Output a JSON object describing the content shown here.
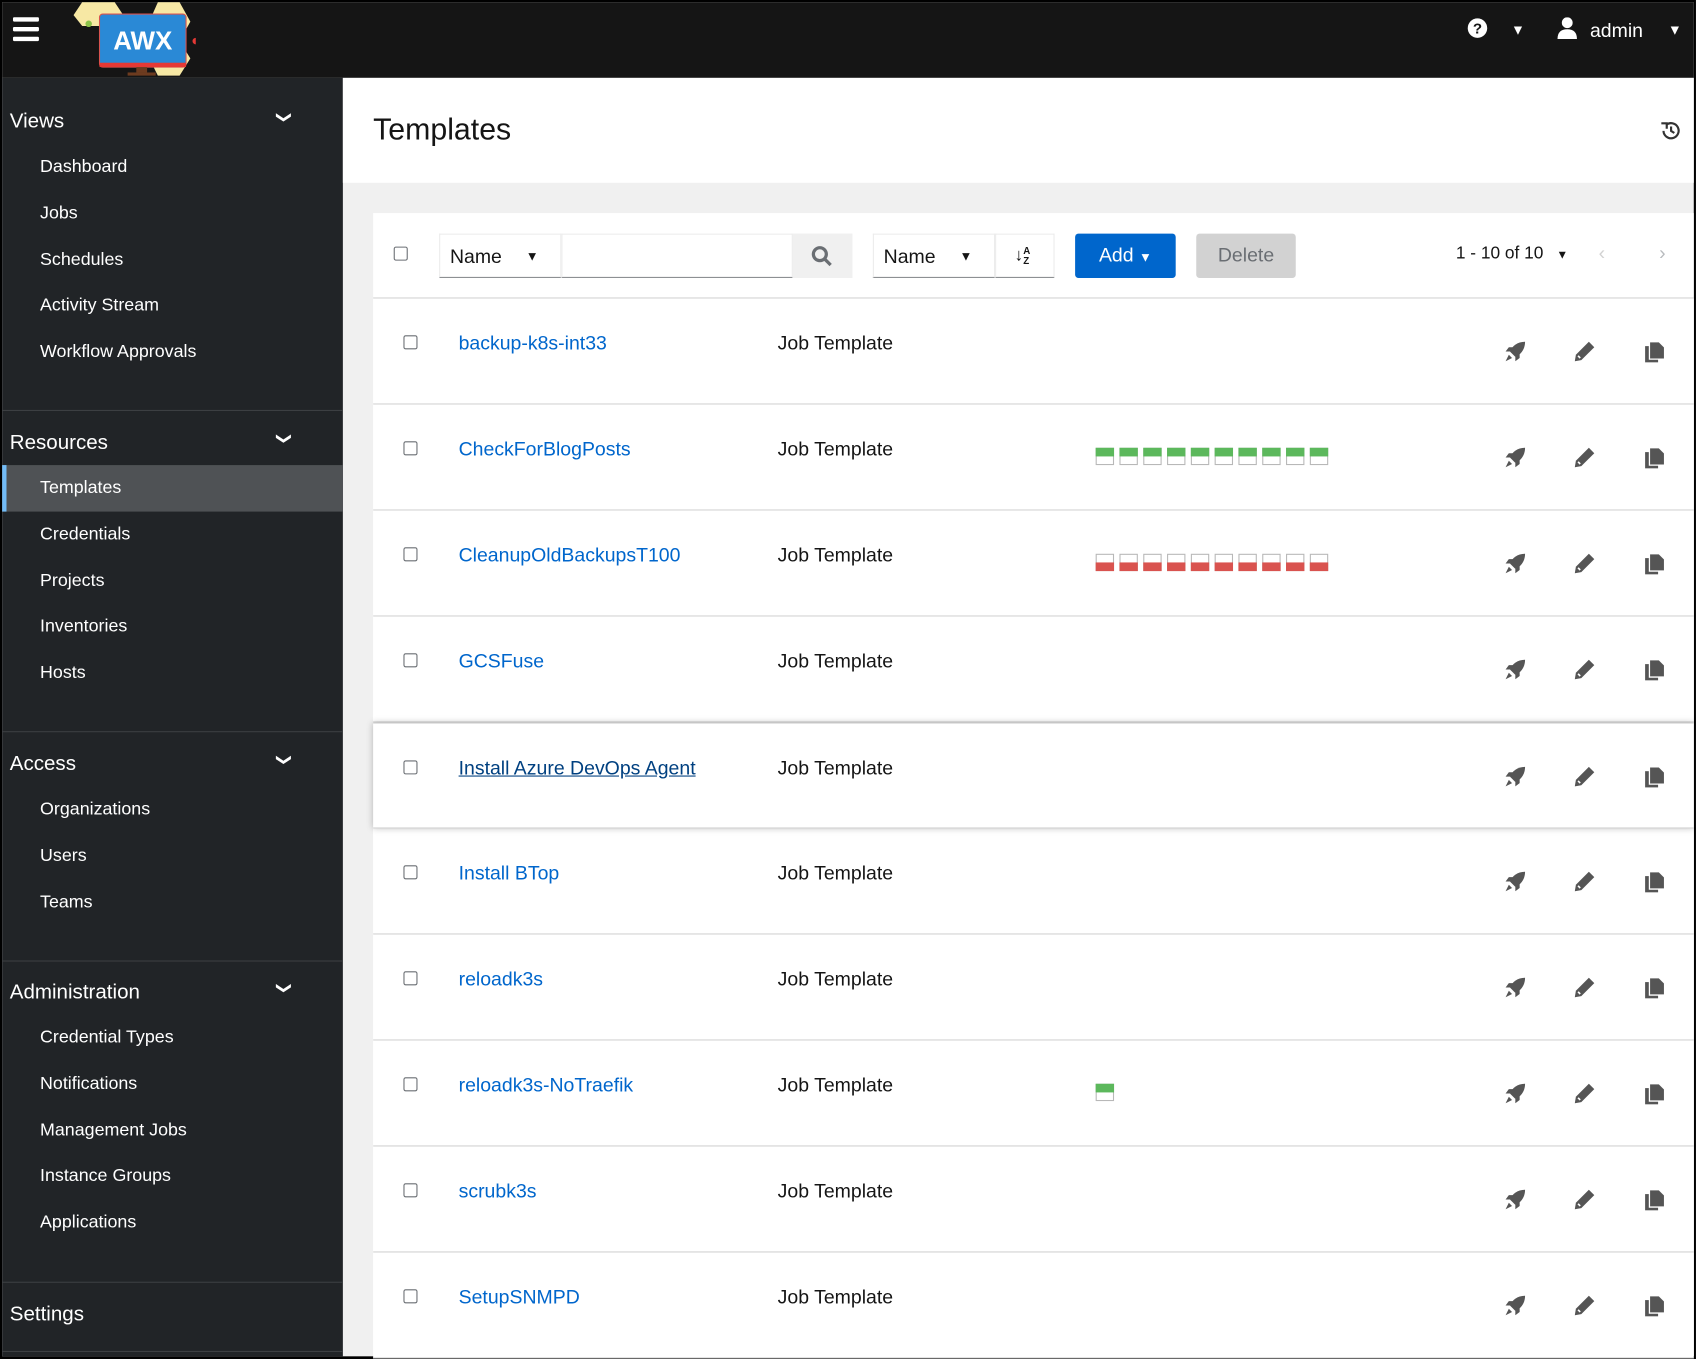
{
  "header": {
    "logo_text": "AWX",
    "user": "admin"
  },
  "sidebar": {
    "sections": [
      {
        "label": "Views",
        "items": [
          "Dashboard",
          "Jobs",
          "Schedules",
          "Activity Stream",
          "Workflow Approvals"
        ]
      },
      {
        "label": "Resources",
        "items": [
          "Templates",
          "Credentials",
          "Projects",
          "Inventories",
          "Hosts"
        ]
      },
      {
        "label": "Access",
        "items": [
          "Organizations",
          "Users",
          "Teams"
        ]
      },
      {
        "label": "Administration",
        "items": [
          "Credential Types",
          "Notifications",
          "Management Jobs",
          "Instance Groups",
          "Applications"
        ]
      },
      {
        "label": "Settings",
        "items": []
      }
    ],
    "active": "Templates"
  },
  "page": {
    "title": "Templates"
  },
  "toolbar": {
    "filter_field": "Name",
    "search_value": "",
    "sort_field": "Name",
    "add_label": "Add",
    "delete_label": "Delete",
    "pagination": "1 - 10 of 10"
  },
  "rows": [
    {
      "name": "backup-k8s-int33",
      "type": "Job Template",
      "jobs": []
    },
    {
      "name": "CheckForBlogPosts",
      "type": "Job Template",
      "jobs": [
        "successful",
        "successful",
        "successful",
        "successful",
        "successful",
        "successful",
        "successful",
        "successful",
        "successful",
        "successful"
      ]
    },
    {
      "name": "CleanupOldBackupsT100",
      "type": "Job Template",
      "jobs": [
        "failed",
        "failed",
        "failed",
        "failed",
        "failed",
        "failed",
        "failed",
        "failed",
        "failed",
        "failed"
      ]
    },
    {
      "name": "GCSFuse",
      "type": "Job Template",
      "jobs": []
    },
    {
      "name": "Install Azure DevOps Agent",
      "type": "Job Template",
      "jobs": [],
      "hovered": true
    },
    {
      "name": "Install BTop",
      "type": "Job Template",
      "jobs": []
    },
    {
      "name": "reloadk3s",
      "type": "Job Template",
      "jobs": []
    },
    {
      "name": "reloadk3s-NoTraefik",
      "type": "Job Template",
      "jobs": [
        "successful"
      ]
    },
    {
      "name": "scrubk3s",
      "type": "Job Template",
      "jobs": []
    },
    {
      "name": "SetupSNMPD",
      "type": "Job Template",
      "jobs": []
    }
  ],
  "colors": {
    "link": "#0066cc",
    "success": "#5cb85c",
    "failed": "#d9534f",
    "primary": "#0066cc"
  }
}
